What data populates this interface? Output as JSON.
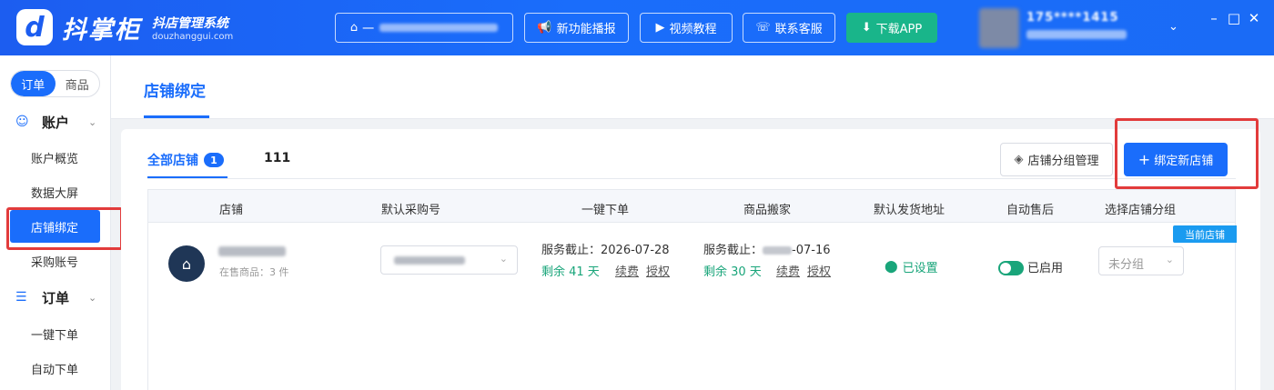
{
  "app": {
    "logo_glyph": "d",
    "brand_name": "抖掌柜",
    "slogan": "抖店管理系统",
    "url": "douzhanggui.com"
  },
  "topbar": {
    "shop_select_prefix": "一",
    "buttons": [
      {
        "label": "新功能播报",
        "icon": "megaphone-icon"
      },
      {
        "label": "视频教程",
        "icon": "video-icon"
      },
      {
        "label": "联系客服",
        "icon": "headset-icon"
      },
      {
        "label": "下载APP",
        "icon": "download-icon"
      }
    ],
    "user_phone": "175****1415",
    "window_controls": [
      "–",
      "□",
      "✕"
    ]
  },
  "sidebar": {
    "segment": [
      "订单",
      "商品"
    ],
    "groups": [
      {
        "label": "账户",
        "icon": "smile-icon",
        "items": [
          "账户概览",
          "数据大屏",
          "店铺绑定",
          "采购账号"
        ]
      },
      {
        "label": "订单",
        "icon": "list-icon",
        "items": [
          "一键下单",
          "自动下单"
        ]
      }
    ],
    "active_item": "店铺绑定"
  },
  "page": {
    "title": "店铺绑定"
  },
  "tabs": [
    {
      "label": "全部店铺",
      "count": "1"
    },
    {
      "label": "111"
    }
  ],
  "actions": {
    "group_manage": "店铺分组管理",
    "bind_new": "绑定新店铺"
  },
  "table": {
    "columns": [
      "店铺",
      "默认采购号",
      "一键下单",
      "商品搬家",
      "默认发货地址",
      "自动售后",
      "选择店铺分组"
    ],
    "rows": [
      {
        "current_tag": "当前店铺",
        "shop_sub": "在售商品：3 件",
        "one_click": {
          "service_label": "服务截止：",
          "service_date": "2026-07-28",
          "remaining": "剩余 41 天",
          "renew": "续费",
          "auth": "授权"
        },
        "move": {
          "service_label": "服务截止：",
          "service_date_suffix": "-07-16",
          "remaining": "剩余 30 天",
          "renew": "续费",
          "auth": "授权"
        },
        "address": "已设置",
        "after_sale": "已启用",
        "after_sale_enabled": true,
        "group": "未分组"
      }
    ]
  },
  "colors": {
    "primary": "#1a6dfb",
    "success": "#19a57a",
    "highlight_red": "#e23b3b",
    "download_green": "#19b58a"
  }
}
